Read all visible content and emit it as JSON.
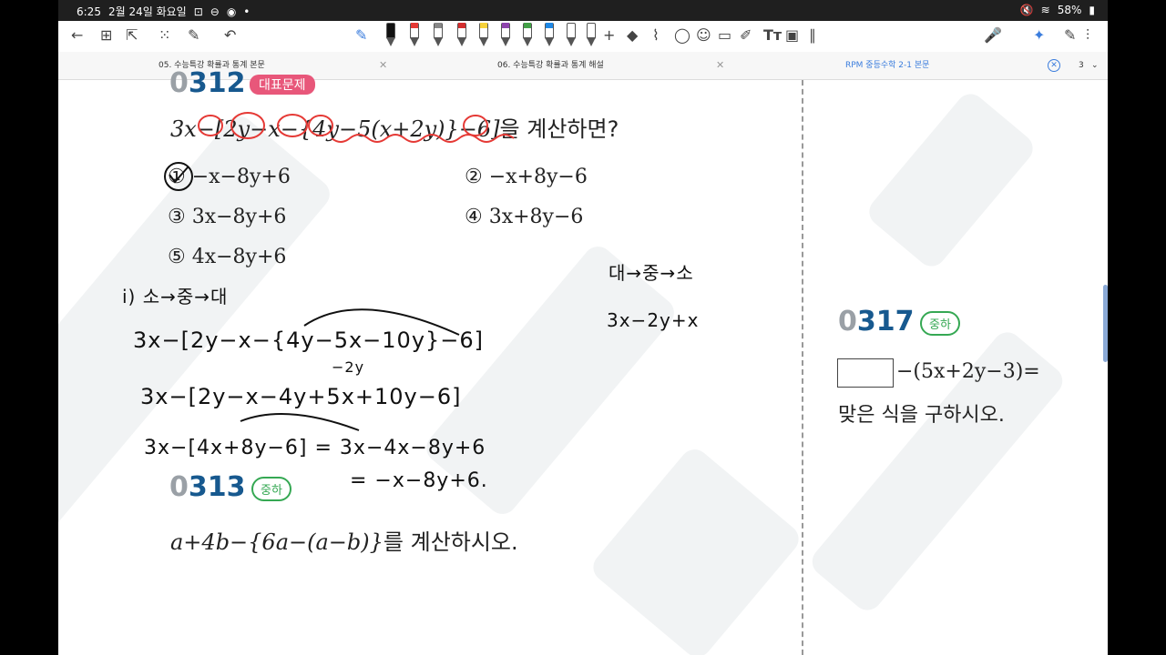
{
  "status": {
    "time": "6:25",
    "date": "2월 24일 화요일",
    "battery": "58%"
  },
  "tabs": [
    {
      "label": "05. 수능특강 확률과 통계 본문"
    },
    {
      "label": "06. 수능특강 확률과 통계 해설"
    },
    {
      "label": "RPM 중등수학 2-1 본문"
    }
  ],
  "tab_count": "3",
  "q312": {
    "number_prefix": "0",
    "number": "312",
    "badge": "대표문제",
    "problem_math": "3x−[2y−x−{4y−5(x+2y)}−6]",
    "problem_text": "을 계산하면?",
    "options": [
      "① −x−8y+6",
      "② −x+8y−6",
      "③ 3x−8y+6",
      "④ 3x+8y−6",
      "⑤ 4x−8y+6"
    ]
  },
  "q313": {
    "number_prefix": "0",
    "number": "313",
    "badge": "중하",
    "problem_math": "a+4b−{6a−(a−b)}",
    "problem_text": "를 계산하시오."
  },
  "q317": {
    "number_prefix": "0",
    "number": "317",
    "badge": "중하",
    "problem_math": "−(5x+2y−3)=",
    "problem_text": "맞은 식을 구하시오."
  },
  "handwriting": {
    "step_label": "i) 소→중→대",
    "line1": "3x−[2y−x−{4y−5x−10y}−6]",
    "note1": "−2y",
    "line2": "3x−[2y−x−4y+5x+10y−6]",
    "line3": "3x−[4x+8y−6] = 3x−4x−8y+6",
    "line4": "= −x−8y+6.",
    "right1": "대→중→소",
    "right2": "3x−2y+x"
  },
  "colors": {
    "red_ink": "#e53935",
    "badge_green": "#35a853",
    "number_blue": "#17598f"
  }
}
